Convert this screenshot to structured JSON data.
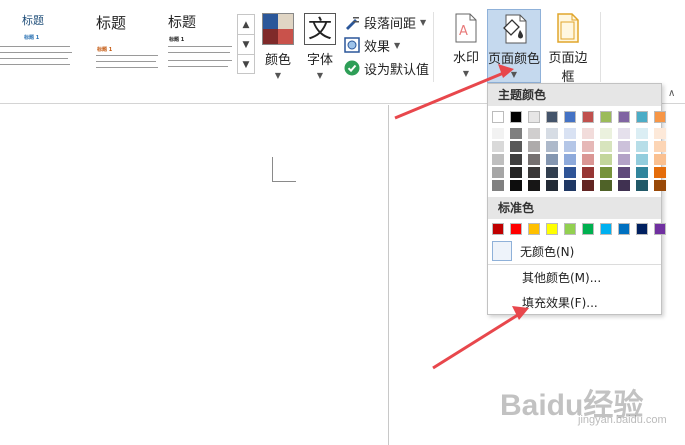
{
  "ribbon": {
    "gallery": {
      "style1": {
        "title": "标题",
        "sub": "标题 1"
      },
      "style2": {
        "title": "标题",
        "sub": "标题 1"
      },
      "style3": {
        "title": "标题",
        "sub": "标题 1"
      }
    },
    "colors_label": "颜色",
    "fonts_label": "字体",
    "fonts_glyph": "文",
    "paragraph_spacing_label": "段落间距",
    "effects_label": "效果",
    "set_default_label": "设为默认值",
    "watermark_label": "水印",
    "page_color_label": "页面颜色",
    "page_border_label": "页面边框"
  },
  "dropdown": {
    "theme_colors_header": "主题颜色",
    "standard_colors_header": "标准色",
    "no_color_label": "无颜色(N)",
    "more_colors_label": "其他颜色(M)...",
    "fill_effects_label": "填充效果(F)...",
    "theme_top": [
      "#ffffff",
      "#000000",
      "#e7e6e6",
      "#44546a",
      "#4472c4",
      "#c0504d",
      "#9bbb59",
      "#8064a2",
      "#4bacc6",
      "#f79646"
    ],
    "theme_shades": [
      [
        "#f2f2f2",
        "#d9d9d9",
        "#bfbfbf",
        "#a6a6a6",
        "#808080"
      ],
      [
        "#7f7f7f",
        "#595959",
        "#3f3f3f",
        "#262626",
        "#0d0d0d"
      ],
      [
        "#d0cece",
        "#aeabab",
        "#757070",
        "#3a3838",
        "#171616"
      ],
      [
        "#d6dce4",
        "#adb9ca",
        "#8496b0",
        "#323f4f",
        "#222a35"
      ],
      [
        "#d9e2f3",
        "#b4c6e7",
        "#8eaadb",
        "#2f5496",
        "#1f3864"
      ],
      [
        "#f2dcdb",
        "#e6b8b7",
        "#da9694",
        "#963634",
        "#632523"
      ],
      [
        "#ebf1de",
        "#d7e4bd",
        "#c3d69b",
        "#77933c",
        "#4f6228"
      ],
      [
        "#e5e0ec",
        "#ccc1da",
        "#b3a2c7",
        "#604a7b",
        "#403151"
      ],
      [
        "#dbeef4",
        "#b7dee8",
        "#93cddd",
        "#31859c",
        "#215968"
      ],
      [
        "#fde9d9",
        "#fcd5b5",
        "#fac090",
        "#e46c0a",
        "#984807"
      ]
    ],
    "standard": [
      "#c00000",
      "#ff0000",
      "#ffc000",
      "#ffff00",
      "#92d050",
      "#00b050",
      "#00b0f0",
      "#0070c0",
      "#002060",
      "#7030a0"
    ]
  },
  "watermark_text": "Baidu经验",
  "watermark_sub": "jingyan.baidu.com",
  "accent": "#e8474c"
}
